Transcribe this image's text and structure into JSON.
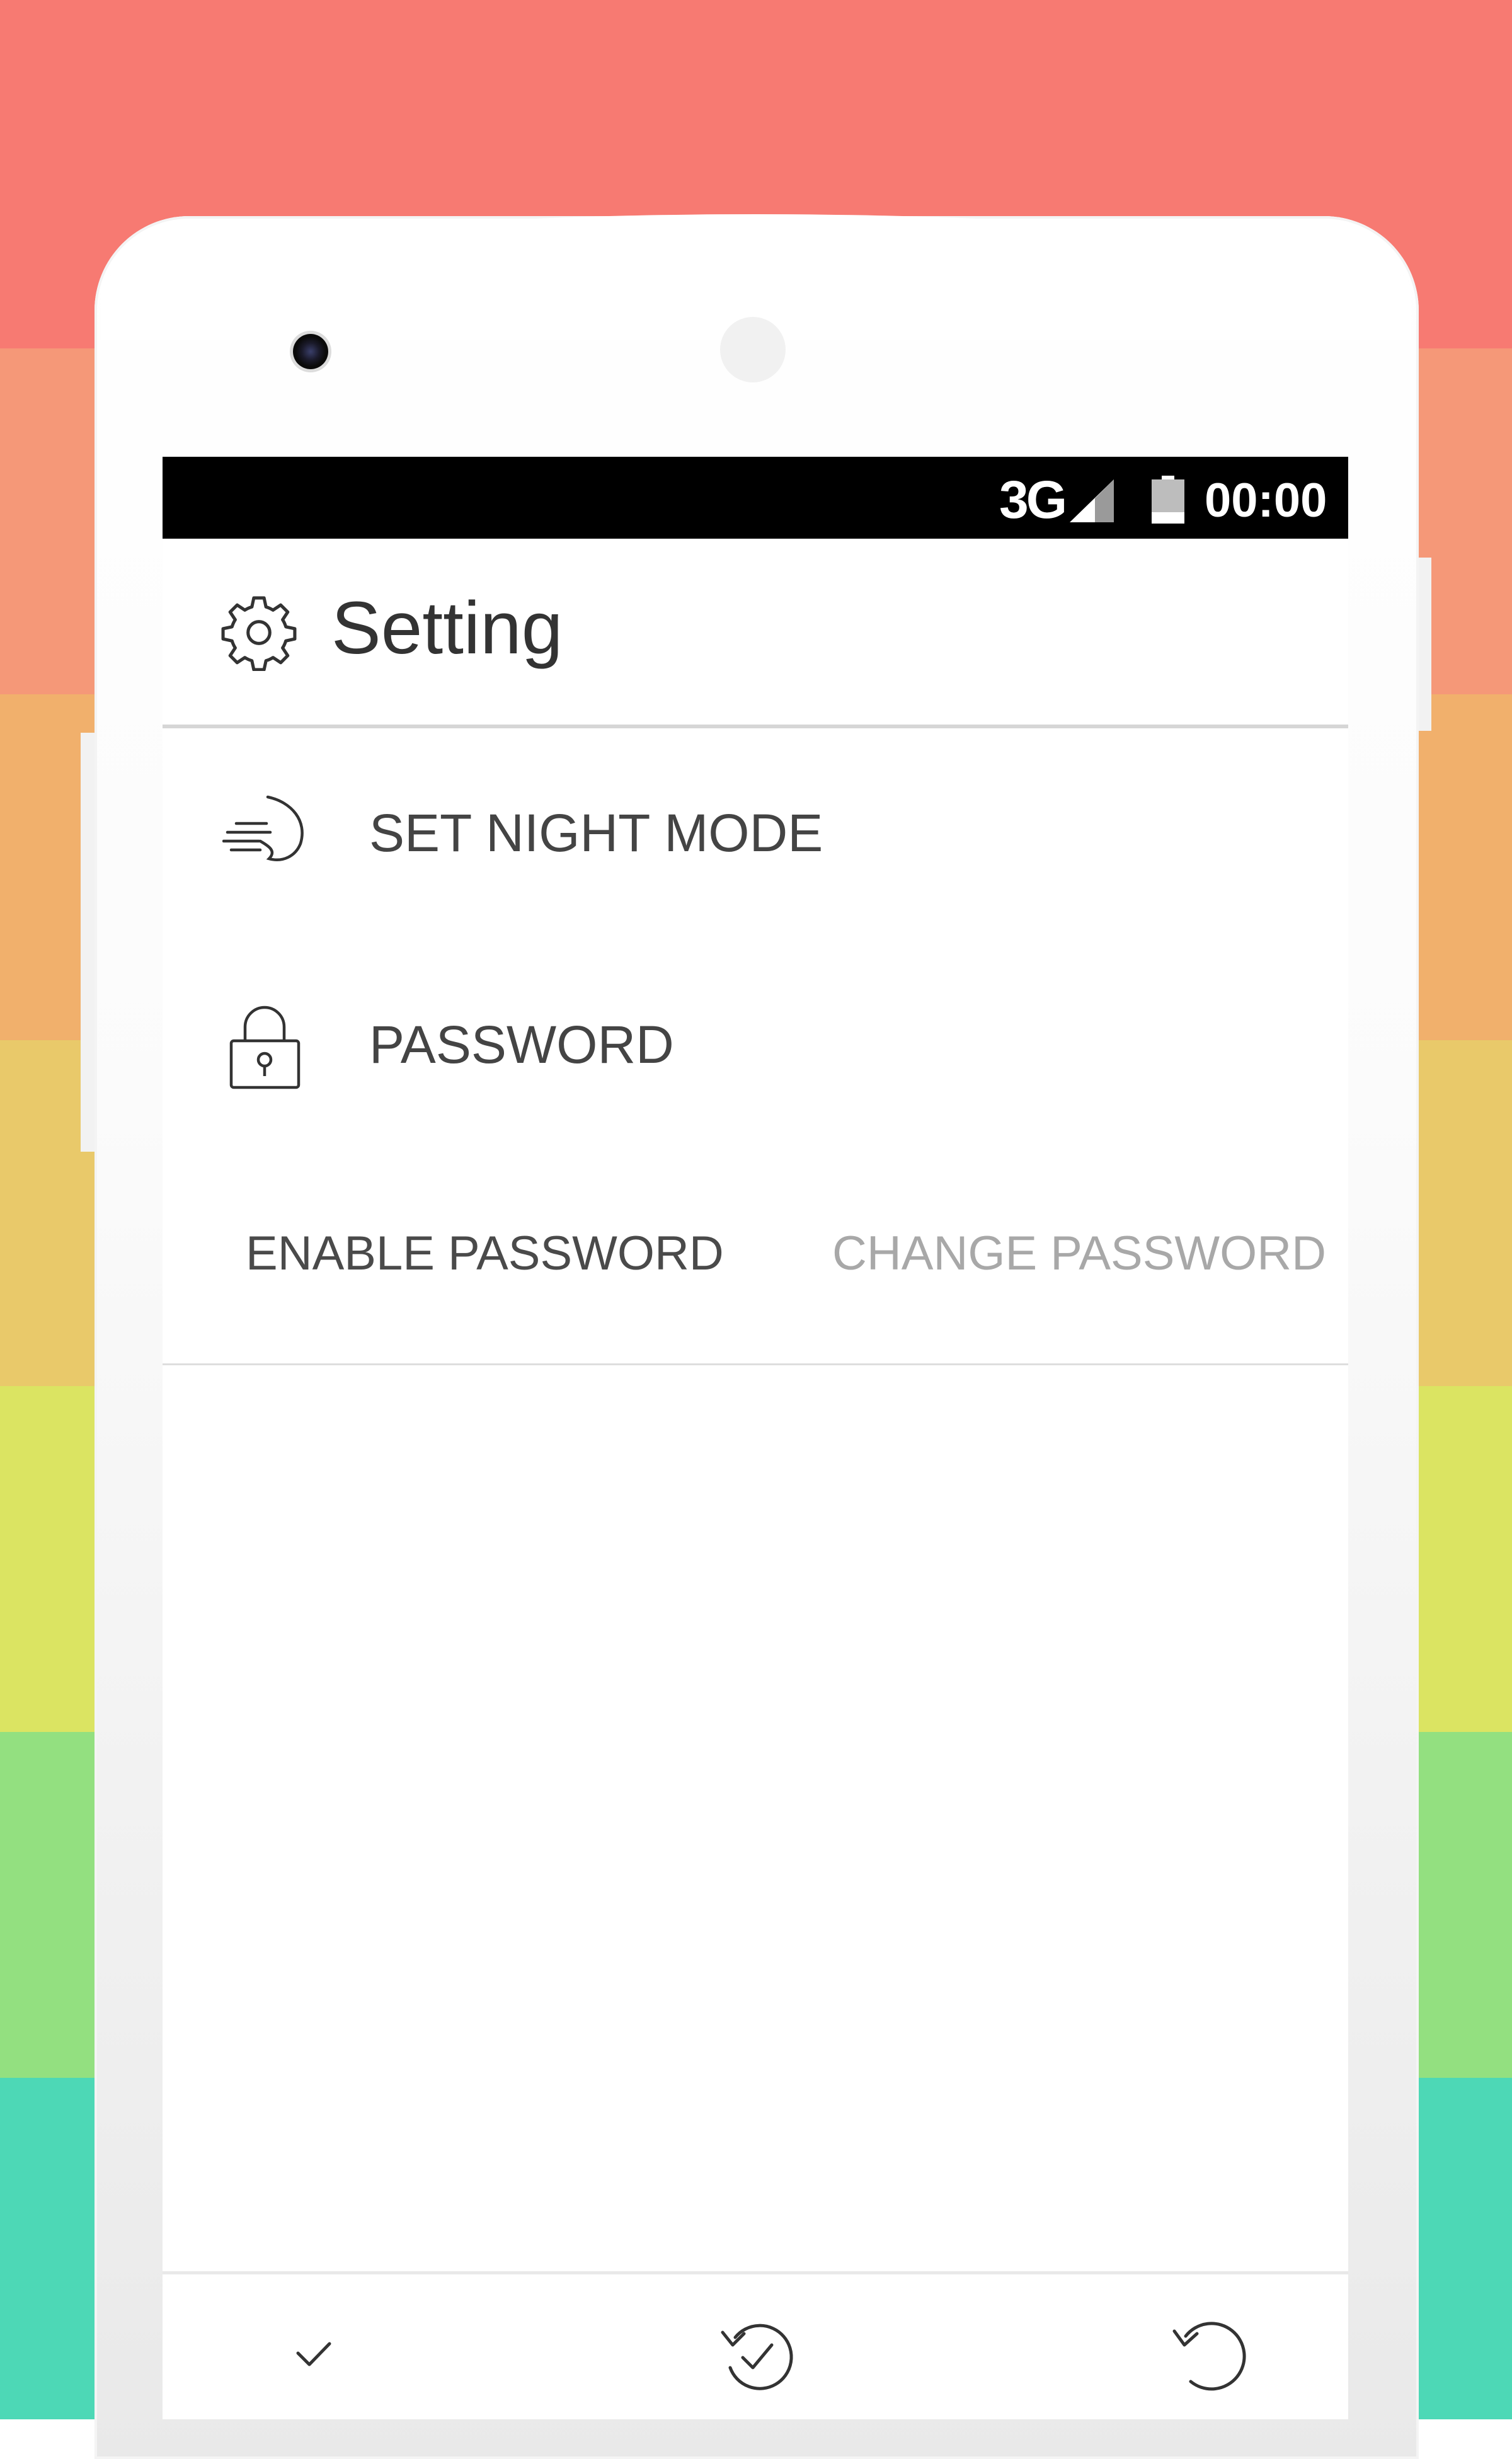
{
  "background": {
    "stripe_colors": [
      "#f77a72",
      "#f59878",
      "#f1b06c",
      "#e9c96a",
      "#dbe462",
      "#93e080",
      "#4dd8b6"
    ]
  },
  "status_bar": {
    "network": "3G",
    "time": "00:00",
    "signal_icon": "signal-icon",
    "battery_icon": "battery-icon"
  },
  "app_bar": {
    "title": "Setting",
    "icon": "gear-icon"
  },
  "settings": {
    "night_mode": {
      "label": "SET NIGHT MODE",
      "icon": "night-mode-icon"
    },
    "password": {
      "label": "PASSWORD",
      "icon": "lock-icon"
    },
    "enable_password": "ENABLE PASSWORD",
    "change_password": "CHANGE PASSWORD"
  },
  "bottom_bar": {
    "icons": [
      "check-icon",
      "refresh-check-icon",
      "undo-icon"
    ]
  },
  "colors": {
    "status_bar_bg": "#000000",
    "primary_text": "#444444",
    "disabled_text": "#a8a8a8"
  }
}
